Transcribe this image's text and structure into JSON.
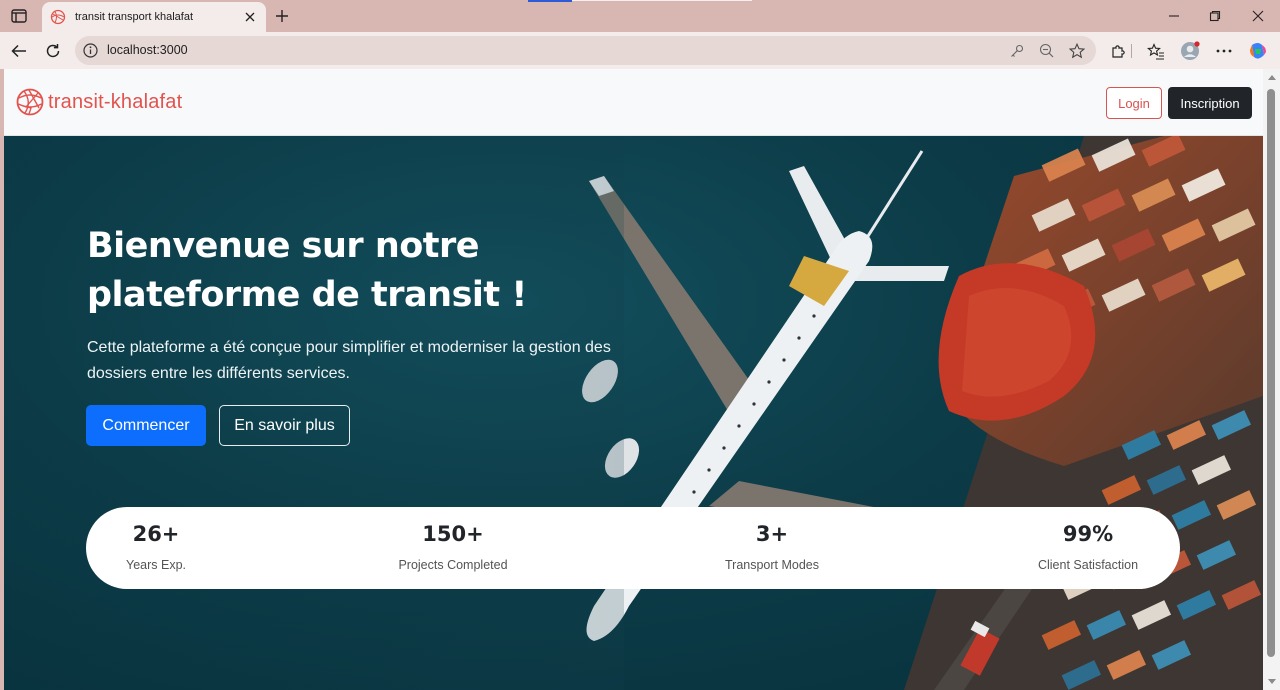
{
  "browser": {
    "tab_title": "transit transport khalafat",
    "url": "localhost:3000"
  },
  "navbar": {
    "brand": "transit-khalafat",
    "login_label": "Login",
    "signup_label": "Inscription"
  },
  "hero": {
    "title_line1": "Bienvenue sur notre",
    "title_line2": "plateforme de transit !",
    "subtitle_line1": "Cette plateforme a été conçue pour simplifier et moderniser la gestion des",
    "subtitle_line2": "dossiers entre les différents services.",
    "primary_label": "Commencer",
    "secondary_label": "En savoir plus"
  },
  "stats": [
    {
      "value": "26+",
      "label": "Years Exp."
    },
    {
      "value": "150+",
      "label": "Projects Completed"
    },
    {
      "value": "3+",
      "label": "Transport Modes"
    },
    {
      "value": "99%",
      "label": "Client Satisfaction"
    }
  ],
  "colors": {
    "brand": "#e2534e",
    "primary": "#0d6efd",
    "dark": "#212529",
    "hero_bg": "#0c3c48",
    "chrome": "#d8b6b1"
  },
  "icons": {
    "tab_actions": "sidebar-toggle-icon",
    "favicon": "globe-icon",
    "back": "back-arrow-icon",
    "reload": "reload-icon",
    "site_info": "info-icon",
    "password": "key-icon",
    "zoom": "zoom-out-icon",
    "favorite": "star-icon",
    "extensions": "puzzle-icon",
    "favorites": "favorites-list-icon",
    "profile": "profile-icon",
    "more": "more-icon",
    "copilot": "copilot-icon"
  }
}
